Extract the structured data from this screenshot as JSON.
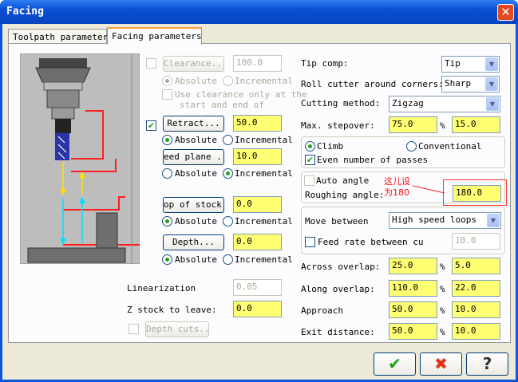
{
  "window": {
    "title": "Facing",
    "close_glyph": "✕"
  },
  "tabs": [
    "Toolpath parameters",
    "Facing parameters"
  ],
  "left": {
    "clearance": {
      "label": "Clearance...",
      "value": "100.0"
    },
    "clearance_abs": "Absolute",
    "clearance_inc": "Incremental",
    "use_clearance_line1": "Use clearance only at the",
    "use_clearance_line2": "start and end of",
    "retract": {
      "label": "Retract...",
      "value": "50.0"
    },
    "retract_abs": "Absolute",
    "retract_inc": "Incremental",
    "feed_plane": {
      "label": "eed plane ...",
      "value": "10.0"
    },
    "feed_abs": "Absolute",
    "feed_inc": "Incremental",
    "top_stock": {
      "label": "op of stock..",
      "value": "0.0"
    },
    "top_abs": "Absolute",
    "top_inc": "Incremental",
    "depth": {
      "label": "Depth...",
      "value": "0.0"
    },
    "depth_abs": "Absolute",
    "depth_inc": "Incremental",
    "linearization": {
      "label": "Linearization",
      "value": "0.05"
    },
    "z_stock": {
      "label": "Z stock to leave:",
      "value": "0.0"
    },
    "depth_cuts": "Depth cuts..."
  },
  "right": {
    "tip_comp": {
      "label": "Tip comp:",
      "value": "Tip"
    },
    "roll_cutter": {
      "label": "Roll cutter around corners:",
      "value": "Sharp"
    },
    "cutting_method": {
      "label": "Cutting method:",
      "value": "Zigzag"
    },
    "max_stepover": {
      "label": "Max. stepover:",
      "value": "75.0",
      "pct": "%",
      "abs_value": "15.0"
    },
    "climb": "Climb",
    "conventional": "Conventional",
    "even_passes": "Even number of passes",
    "auto_angle": "Auto angle",
    "roughing_angle": {
      "label": "Roughing angle:",
      "value": "180.0"
    },
    "annotation_line1": "这儿设",
    "annotation_line2": "为180",
    "move_between": {
      "label": "Move between",
      "value": "High speed loops"
    },
    "feed_rate_between": {
      "label": "Feed rate between cu",
      "value": "10.0"
    },
    "across_overlap": {
      "label": "Across overlap:",
      "value": "25.0",
      "pct": "%",
      "abs_value": "5.0"
    },
    "along_overlap": {
      "label": "Along overlap:",
      "value": "110.0",
      "pct": "%",
      "abs_value": "22.0"
    },
    "approach": {
      "label": "Approach",
      "value": "50.0",
      "pct": "%",
      "abs_value": "10.0"
    },
    "exit_distance": {
      "label": "Exit distance:",
      "value": "50.0",
      "pct": "%",
      "abs_value": "10.0"
    }
  },
  "footer": {
    "ok": "✔",
    "cancel": "✖",
    "help": "?"
  },
  "icons": {
    "dropdown": "▼",
    "check": "✔"
  }
}
